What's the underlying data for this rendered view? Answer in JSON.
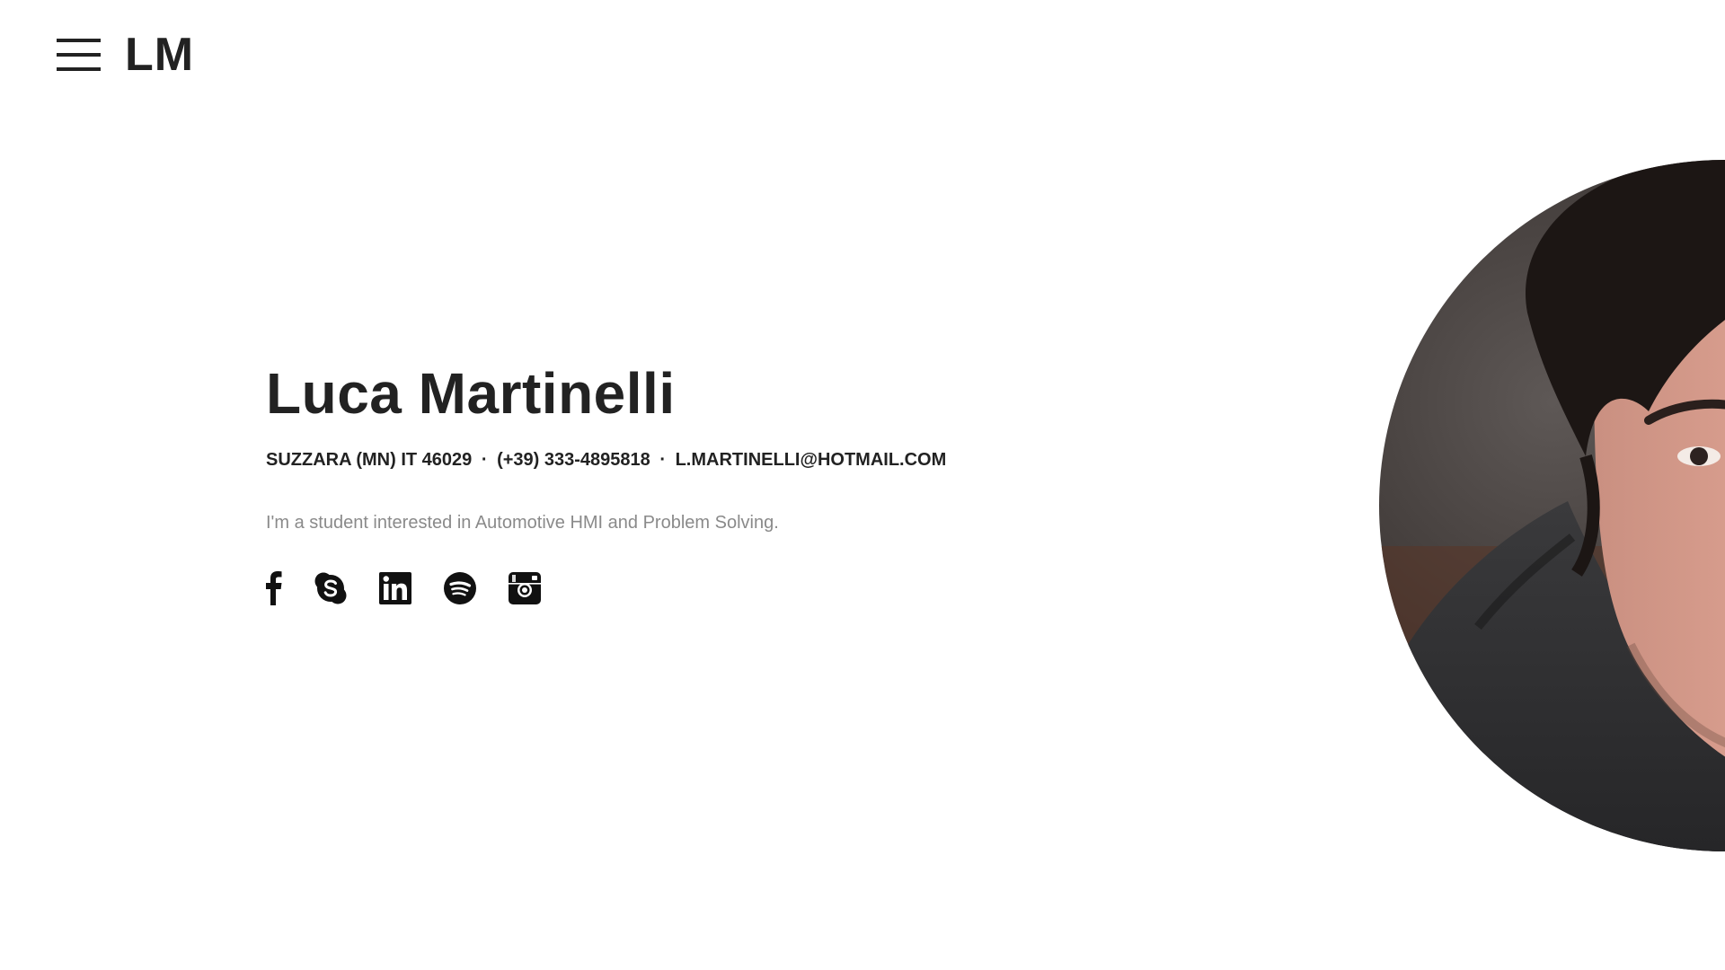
{
  "header": {
    "logo_text": "LM",
    "menu_icon": "hamburger-menu-icon"
  },
  "profile": {
    "name": "Luca Martinelli",
    "contact": {
      "location": "SUZZARA (MN) IT 46029",
      "separator": "·",
      "phone": "(+39) 333-4895818",
      "email": "L.MARTINELLI@HOTMAIL.COM"
    },
    "tagline": "I'm a student interested in Automotive HMI and Problem Solving."
  },
  "social_links": [
    {
      "name": "facebook",
      "icon": "facebook-icon"
    },
    {
      "name": "skype",
      "icon": "skype-icon"
    },
    {
      "name": "linkedin",
      "icon": "linkedin-icon"
    },
    {
      "name": "spotify",
      "icon": "spotify-icon"
    },
    {
      "name": "instagram",
      "icon": "instagram-icon"
    }
  ],
  "portrait": {
    "icon": "profile-photo"
  },
  "colors": {
    "text": "#222222",
    "muted": "#8a8a8a",
    "background": "#ffffff"
  }
}
